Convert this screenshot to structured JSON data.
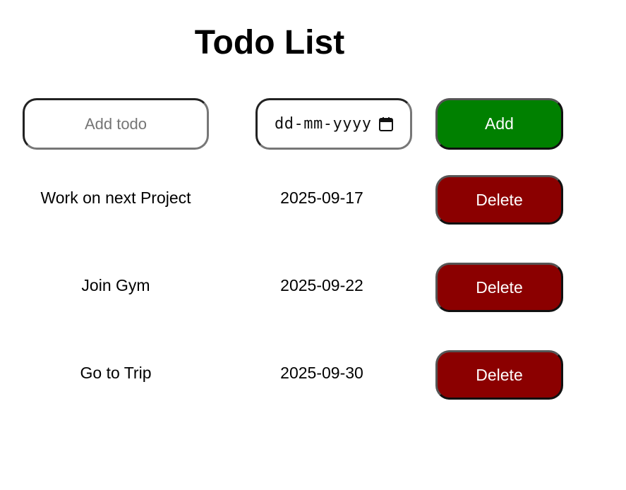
{
  "header": {
    "title": "Todo List"
  },
  "form": {
    "todo_placeholder": "Add todo",
    "todo_value": "",
    "date_placeholder": "dd-mm-yyyy",
    "add_label": "Add",
    "add_color": "#008000"
  },
  "todos": [
    {
      "name": "Work on next Project",
      "date": "2025-09-17",
      "delete_label": "Delete"
    },
    {
      "name": "Join Gym",
      "date": "2025-09-22",
      "delete_label": "Delete"
    },
    {
      "name": "Go to Trip",
      "date": "2025-09-30",
      "delete_label": "Delete"
    }
  ],
  "colors": {
    "delete": "#8b0000",
    "add": "#008000"
  },
  "icons": {
    "date_picker": "calendar-icon"
  }
}
